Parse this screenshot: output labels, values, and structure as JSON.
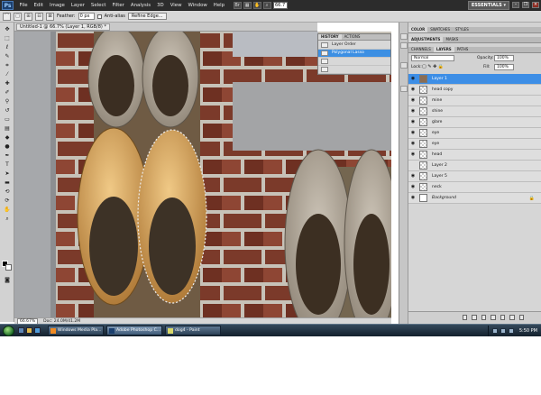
{
  "menu": {
    "logo": "Ps",
    "items": [
      "File",
      "Edit",
      "Image",
      "Layer",
      "Select",
      "Filter",
      "Analysis",
      "3D",
      "View",
      "Window",
      "Help"
    ],
    "zoom": "66.7",
    "workspace": "ESSENTIALS ▾"
  },
  "options": {
    "feather_label": "Feather:",
    "feather_value": "0 px",
    "antialias_label": "Anti-alias",
    "refine_edge_label": "Refine Edge..."
  },
  "document": {
    "tab_title": "Untitled-1 @ 66.7% (Layer 1, RGB/8) *",
    "zoom": "66.67%",
    "doc_info": "Doc: 24.0M/41.2M"
  },
  "history": {
    "tabs": [
      "HISTORY",
      "ACTIONS"
    ],
    "items": [
      {
        "label": "Layer Order"
      },
      {
        "label": "Polygonal Lasso"
      },
      {
        "label": ""
      },
      {
        "label": ""
      }
    ]
  },
  "dock": {
    "top_tabs": [
      "COLOR",
      "SWATCHES",
      "STYLES"
    ],
    "adjust_tabs": [
      "ADJUSTMENTS",
      "MASKS"
    ],
    "layers_tabs": [
      "CHANNELS",
      "LAYERS",
      "PATHS"
    ],
    "blend_mode": "Normal",
    "opacity_label": "Opacity:",
    "opacity_value": "100%",
    "lock_label": "Lock:",
    "fill_label": "Fill:",
    "fill_value": "100%"
  },
  "layers": [
    {
      "name": "Layer 1",
      "selected": true,
      "thumb": "photo"
    },
    {
      "name": "head copy",
      "selected": false,
      "thumb": "trans"
    },
    {
      "name": "mine",
      "selected": false,
      "thumb": "trans"
    },
    {
      "name": "shine",
      "selected": false,
      "thumb": "trans"
    },
    {
      "name": "glare",
      "selected": false,
      "thumb": "trans"
    },
    {
      "name": "eye",
      "selected": false,
      "thumb": "trans"
    },
    {
      "name": "eye",
      "selected": false,
      "thumb": "trans"
    },
    {
      "name": "head",
      "selected": false,
      "thumb": "trans"
    },
    {
      "name": "Layer 2",
      "selected": false,
      "thumb": "trans"
    },
    {
      "name": "Layer 5",
      "selected": false,
      "thumb": "trans"
    },
    {
      "name": "neck",
      "selected": false,
      "thumb": "trans"
    },
    {
      "name": "Background",
      "selected": false,
      "thumb": "white"
    }
  ],
  "taskbar": {
    "items": [
      {
        "label": "Windows Media Pla..."
      },
      {
        "label": "Adobe Photoshop C..."
      },
      {
        "label": "dog4 - Paint"
      }
    ],
    "clock": "5:50 PM"
  }
}
